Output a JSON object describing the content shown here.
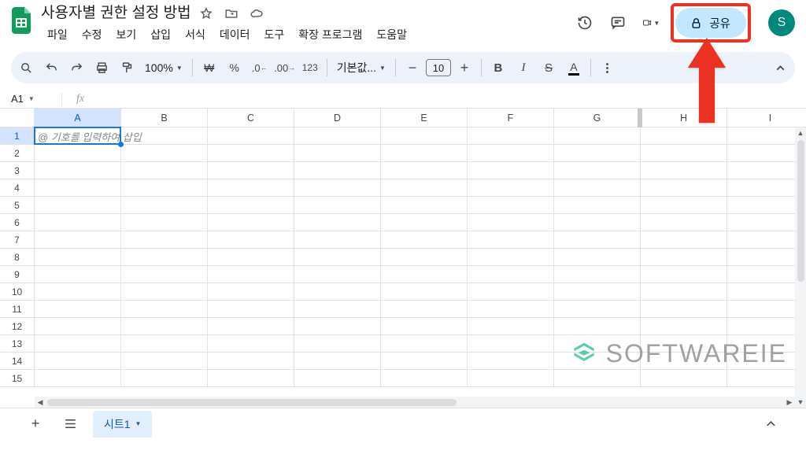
{
  "doc": {
    "title": "사용자별 권한 설정 방법"
  },
  "menus": [
    "파일",
    "수정",
    "보기",
    "삽입",
    "서식",
    "데이터",
    "도구",
    "확장 프로그램",
    "도움말"
  ],
  "header_icons": {
    "history": "history-icon",
    "comments": "comments-icon",
    "meet": "meet-icon"
  },
  "share": {
    "label": "공유"
  },
  "avatar": {
    "initial": "S"
  },
  "toolbar": {
    "zoom": "100%",
    "font": "기본값...",
    "font_size": "10"
  },
  "namebox": {
    "value": "A1"
  },
  "formula_bar": {
    "fx": "fx"
  },
  "columns": [
    "A",
    "B",
    "C",
    "D",
    "E",
    "F",
    "G",
    "H",
    "I"
  ],
  "rows": [
    1,
    2,
    3,
    4,
    5,
    6,
    7,
    8,
    9,
    10,
    11,
    12,
    13,
    14,
    15
  ],
  "active_cell": {
    "row": 1,
    "col": "A",
    "placeholder": "@ 기호를 입력하여 삽입"
  },
  "sheet_tabs": {
    "active": "시트1"
  },
  "watermark": {
    "text": "SOFTWAREIE"
  }
}
